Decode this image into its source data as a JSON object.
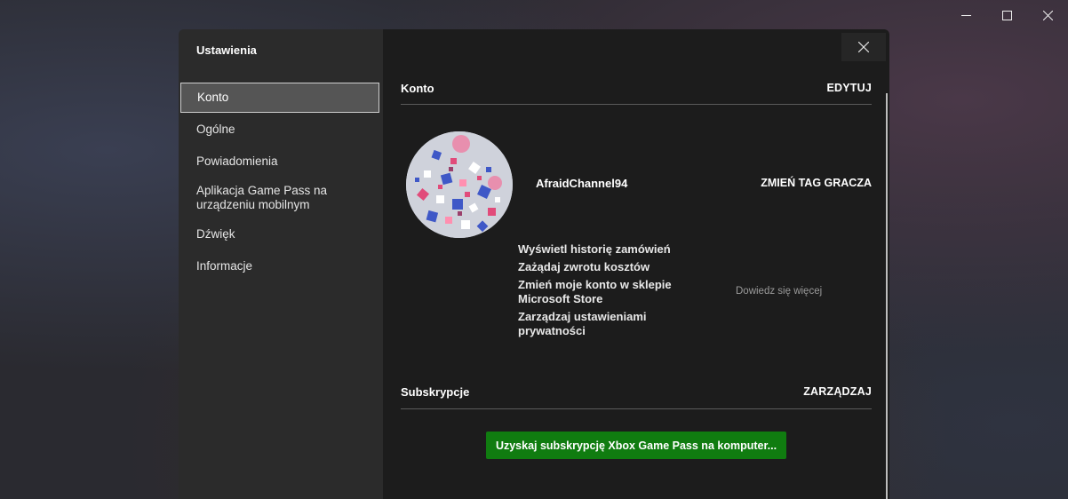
{
  "sidebar": {
    "title": "Ustawienia",
    "items": [
      {
        "label": "Konto"
      },
      {
        "label": "Ogólne"
      },
      {
        "label": "Powiadomienia"
      },
      {
        "label": "Aplikacja Game Pass na urządzeniu mobilnym"
      },
      {
        "label": "Dźwięk"
      },
      {
        "label": "Informacje"
      }
    ],
    "selected": "Konto"
  },
  "account": {
    "section_title": "Konto",
    "edit_label": "EDYTUJ",
    "gamertag": "AfraidChannel94",
    "change_gamertag_label": "ZMIEŃ TAG GRACZA",
    "links": [
      "Wyświetl historię zamówień",
      "Zażądaj zwrotu kosztów",
      "Zmień moje konto w sklepie Microsoft Store",
      "Zarządzaj ustawieniami prywatności"
    ],
    "learn_more": "Dowiedz się więcej"
  },
  "subscriptions": {
    "section_title": "Subskrypcje",
    "manage_label": "ZARZĄDZAJ",
    "get_gamepass_label": "Uzyskaj subskrypcję Xbox Game Pass na komputer..."
  },
  "colors": {
    "accent_green": "#107c10",
    "sidebar_bg": "#2b2b2b",
    "main_bg": "#1c1c1c"
  },
  "icons": {
    "minimize": "minimize-icon",
    "maximize": "maximize-icon",
    "close_window": "close-window-icon",
    "close_dialog": "close-icon"
  }
}
